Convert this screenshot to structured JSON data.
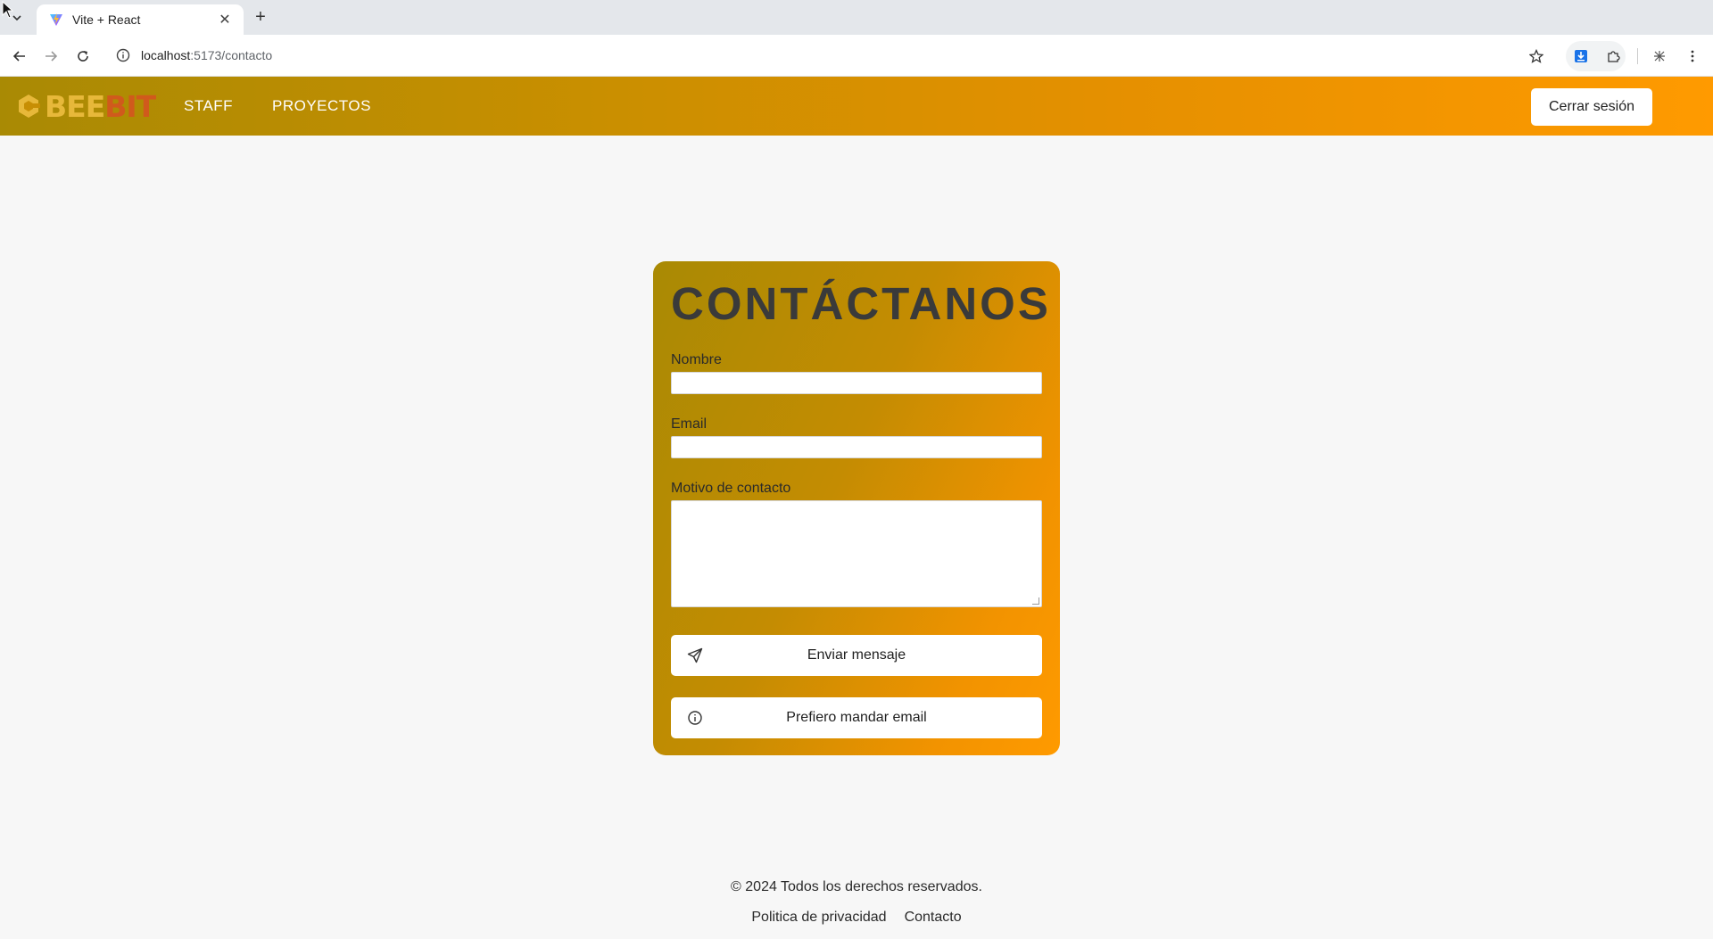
{
  "browser": {
    "tab_title": "Vite + React",
    "url_host": "localhost",
    "url_path": ":5173/contacto"
  },
  "navbar": {
    "brand_part1": "BEE",
    "brand_part2": "BIT",
    "links": [
      {
        "label": "STAFF"
      },
      {
        "label": "PROYECTOS"
      }
    ],
    "logout_label": "Cerrar sesión"
  },
  "contact_form": {
    "title": "CONTÁCTANOS",
    "name_label": "Nombre",
    "name_value": "",
    "email_label": "Email",
    "email_value": "",
    "reason_label": "Motivo de contacto",
    "reason_value": "",
    "send_label": "Enviar mensaje",
    "email_alt_label": "Prefiero mandar email"
  },
  "footer": {
    "copyright": "© 2024 Todos los derechos reservados.",
    "links": [
      {
        "label": "Politica de privacidad"
      },
      {
        "label": "Contacto"
      }
    ]
  },
  "colors": {
    "brand_gradient_start": "#a98a04",
    "brand_gradient_end": "#ff9a00",
    "brand_bee": "#e7b83a",
    "brand_bit": "#d05a1c"
  }
}
